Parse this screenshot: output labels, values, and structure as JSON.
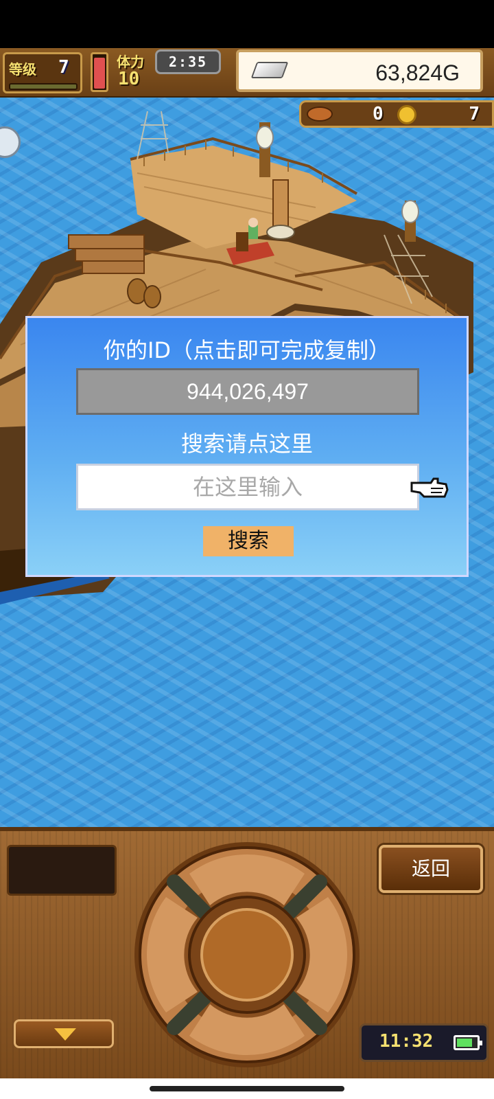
{
  "hud": {
    "level_label": "等级",
    "level_value": "7",
    "stamina_label": "体力",
    "stamina_value": "10",
    "stamina_fraction": 0.95,
    "clock": "2:35",
    "gold": "63,824G",
    "item1_count": "0",
    "item2_count": "7"
  },
  "dialog": {
    "title": "你的ID（点击即可完成复制）",
    "user_id": "944,026,497",
    "search_label": "搜索请点这里",
    "search_placeholder": "在这里输入",
    "search_value": "",
    "search_button": "搜索"
  },
  "console": {
    "back_button": "返回",
    "device_time": "11:32",
    "battery_fraction": 0.8
  },
  "colors": {
    "dialog_top": "#3a86ef",
    "dialog_bottom": "#8ad0f7",
    "id_box": "#999999",
    "search_button": "#f0b268",
    "sea": "#3f9de0",
    "wood": "#a06a34"
  },
  "icons": [
    "silver-bar-icon",
    "meat-icon",
    "medal-icon",
    "speech-bubble-icon",
    "pointer-hand-icon",
    "down-arrow-icon",
    "battery-icon",
    "ship-wheel"
  ]
}
